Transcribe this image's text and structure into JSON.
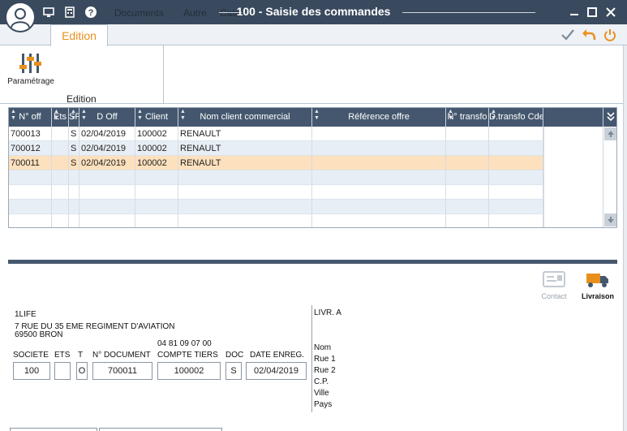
{
  "window": {
    "title": "100 - Saisie des commandes",
    "ghost_menu": [
      "Documents",
      "Autre",
      "Cata"
    ]
  },
  "ribbon": {
    "tab_label": "Edition",
    "param_label": "Paramétrage",
    "group_label": "Edition"
  },
  "grid": {
    "columns": [
      {
        "label": "N° off"
      },
      {
        "label": "Ets"
      },
      {
        "label": "SF"
      },
      {
        "label": "D Off"
      },
      {
        "label": "Client"
      },
      {
        "label": "Nom client commercial"
      },
      {
        "label": "Référence offre"
      },
      {
        "label": "N° transfo"
      },
      {
        "label": "D.transfo Cde"
      }
    ],
    "rows": [
      [
        "700013",
        "",
        "S",
        "02/04/2019",
        "100002",
        "RENAULT",
        "",
        "",
        ""
      ],
      [
        "700012",
        "",
        "S",
        "02/04/2019",
        "100002",
        "RENAULT",
        "",
        "",
        ""
      ],
      [
        "700011",
        "",
        "S",
        "02/04/2019",
        "100002",
        "RENAULT",
        "",
        "",
        ""
      ],
      [
        "",
        "",
        "",
        "",
        "",
        "",
        "",
        "",
        ""
      ],
      [
        "",
        "",
        "",
        "",
        "",
        "",
        "",
        "",
        ""
      ],
      [
        "",
        "",
        "",
        "",
        "",
        "",
        "",
        "",
        ""
      ],
      [
        "",
        "",
        "",
        "",
        "",
        "",
        "",
        "",
        ""
      ]
    ],
    "selected_row": 2
  },
  "detail": {
    "contact_label": "Contact",
    "livraison_label": "Livraison",
    "company_name": "1LIFE",
    "address_line": "7 RUE DU 35 EME REGIMENT D'AVIATION",
    "city_line": "69500 BRON",
    "phone": "04 81 09 07 00",
    "labels": {
      "societe": "SOCIETE",
      "ets": "ETS",
      "t": "T",
      "n_document": "N° DOCUMENT",
      "compte_tiers": "COMPTE TIERS",
      "doc": "DOC",
      "date_enreg": "DATE ENREG."
    },
    "values": {
      "societe": "100",
      "ets": "",
      "t": "O",
      "n_document": "700011",
      "compte_tiers": "100002",
      "doc": "S",
      "date_enreg": "02/04/2019"
    },
    "delivery_title": "LIVR. A",
    "delivery_fields": [
      "Nom",
      "Rue 1",
      "Rue 2",
      "C.P.",
      "Ville",
      "Pays"
    ]
  },
  "colors": {
    "titlebar": "#3a4a5e",
    "accent": "#e8901c",
    "header": "#44576e",
    "selected_row": "#fde0bd"
  }
}
